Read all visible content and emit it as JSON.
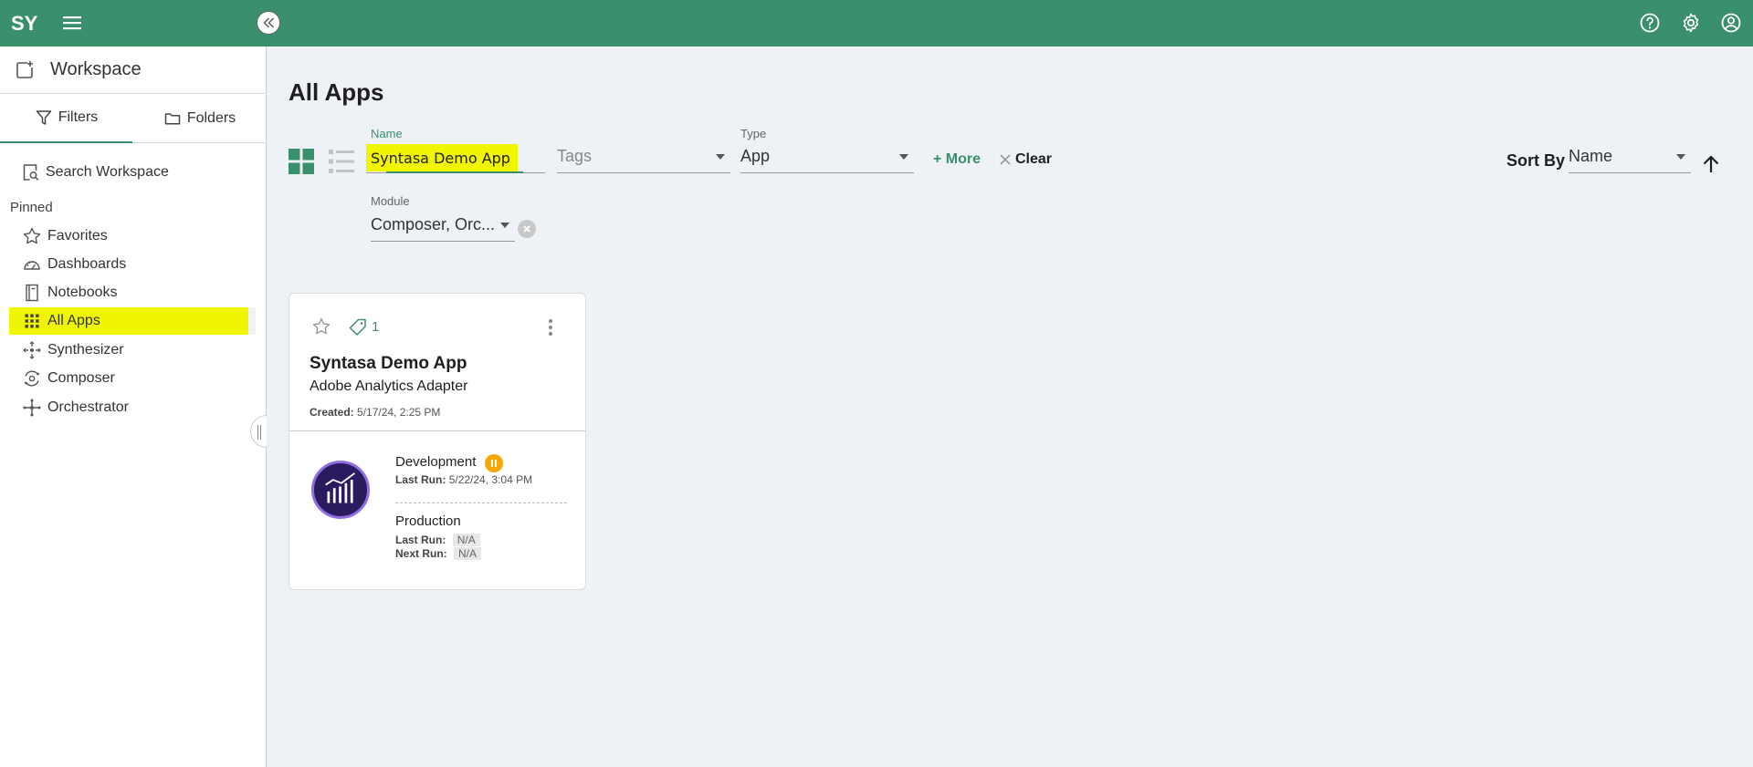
{
  "topbar": {
    "logo_text": "SY",
    "icons": [
      "help-icon",
      "settings-gear-icon",
      "account-icon"
    ]
  },
  "sidebar": {
    "title": "Workspace",
    "tabs": [
      {
        "label": "Filters",
        "active": true
      },
      {
        "label": "Folders",
        "active": false
      }
    ],
    "search_label": "Search Workspace",
    "pinned_label": "Pinned",
    "items": [
      {
        "label": "Favorites",
        "icon": "star-icon"
      },
      {
        "label": "Dashboards",
        "icon": "dashboard-gauge-icon"
      },
      {
        "label": "Notebooks",
        "icon": "notebook-icon"
      },
      {
        "label": "All Apps",
        "icon": "apps-grid-icon",
        "active": true
      },
      {
        "label": "Synthesizer",
        "icon": "synthesizer-icon"
      },
      {
        "label": "Composer",
        "icon": "composer-icon"
      },
      {
        "label": "Orchestrator",
        "icon": "orchestrator-icon"
      }
    ]
  },
  "main": {
    "title": "All Apps",
    "filters": {
      "name_label": "Name",
      "name_value": "Syntasa Demo App",
      "tags_placeholder": "Tags",
      "type_label": "Type",
      "type_value": "App",
      "more_label": "More",
      "clear_label": "Clear",
      "module_label": "Module",
      "module_value": "Composer, Orc..."
    },
    "sort": {
      "label": "Sort By",
      "value": "Name",
      "direction": "ascending"
    },
    "card": {
      "tag_count": "1",
      "name": "Syntasa Demo App",
      "subtitle": "Adobe Analytics Adapter",
      "created_label": "Created:",
      "created_value": "5/17/24, 2:25 PM",
      "development": {
        "name": "Development",
        "status": "paused",
        "last_run_label": "Last Run:",
        "last_run_value": "5/22/24, 3:04 PM"
      },
      "production": {
        "name": "Production",
        "last_run_label": "Last Run:",
        "last_run_value": "N/A",
        "next_run_label": "Next Run:",
        "next_run_value": "N/A"
      }
    }
  },
  "colors": {
    "brand_green": "#3a8f6d",
    "highlight_yellow": "#f0f500",
    "pause_orange": "#f5a800",
    "adobe_logo_purple": "#2a1a5e"
  }
}
